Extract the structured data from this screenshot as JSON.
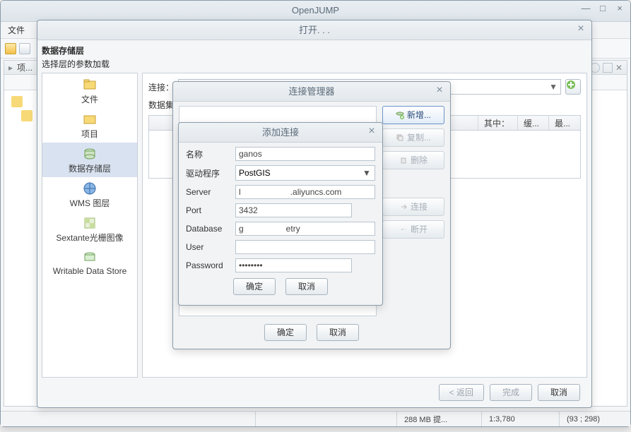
{
  "app": {
    "title": "OpenJUMP"
  },
  "main_menu": {
    "file": "文件"
  },
  "project_tab": "项...",
  "status": {
    "mem": "288 MB 提...",
    "scale": "1:3,780",
    "coords": "(93 ; 298)"
  },
  "open": {
    "title": "打开. . .",
    "heading": "数据存储层",
    "subheading": "选择层的参数加载",
    "sidebar": [
      {
        "label": "文件"
      },
      {
        "label": "项目"
      },
      {
        "label": "数据存储层"
      },
      {
        "label": "WMS 图层"
      },
      {
        "label": "Sextante光栅图像"
      },
      {
        "label": "Writable Data Store"
      }
    ],
    "conn_label": "连接：",
    "dataset_label": "数据集",
    "cols": {
      "mid": "其中：",
      "cache": "缓...",
      "max": "最..."
    },
    "back": "< 返回",
    "finish": "完成",
    "cancel": "取消"
  },
  "connmgr": {
    "title": "连接管理器",
    "add": "新增...",
    "copy": "复制...",
    "delete": "删除",
    "connect": "连接",
    "disconnect": "断开",
    "ok": "确定",
    "cancel": "取消"
  },
  "addconn": {
    "title": "添加连接",
    "name_label": "名称",
    "name_value": "ganos",
    "driver_label": "驱动程序",
    "driver_value": "PostGIS",
    "server_label": "Server",
    "server_value": "l                     .aliyuncs.com",
    "port_label": "Port",
    "port_value": "3432",
    "db_label": "Database",
    "db_value": "g                  etry",
    "user_label": "User",
    "user_value": "",
    "password_label": "Password",
    "password_value": "••••••••",
    "ok": "确定",
    "cancel": "取消"
  }
}
